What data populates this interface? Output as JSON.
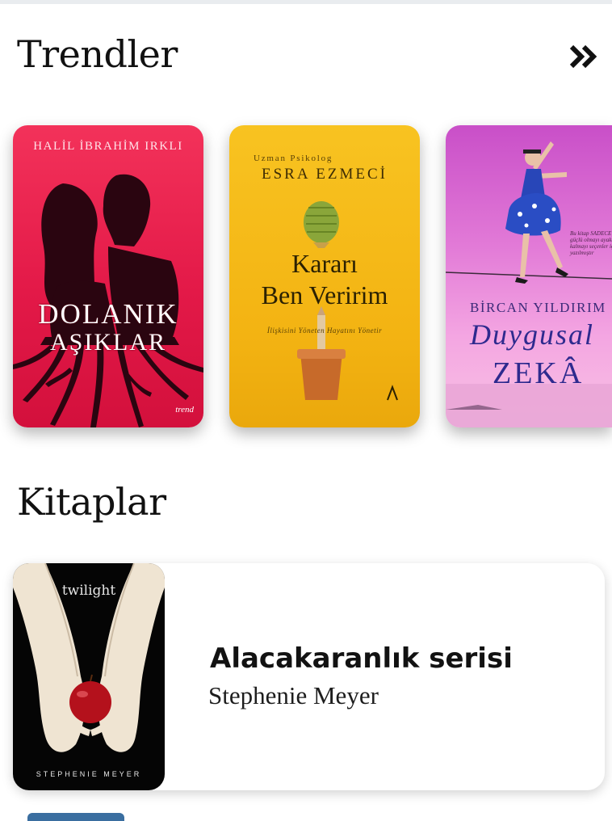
{
  "sections": {
    "trending_title": "Trendler",
    "books_title": "Kitaplar"
  },
  "icons": {
    "more": "double-chevron-right-icon"
  },
  "trending": [
    {
      "author": "HALİL İBRAHİM IRKLI",
      "title_line1": "DOLANIK",
      "title_line2": "AŞIKLAR",
      "publisher": "trend",
      "color": "#e31948"
    },
    {
      "subtitle": "Uzman Psikolog",
      "author": "ESRA EZMECİ",
      "title_line1": "Kararı",
      "title_line2": "Ben Veririm",
      "tagline": "İlişkisini Yöneten   Hayatını Yönetir",
      "color": "#f3b312"
    },
    {
      "note": "Bu kitap SADECE güçlü olmayı ayakta kalmayı seçenler için yazılmıştır",
      "author": "BİRCAN YILDIRIM",
      "title_line1": "Duygusal",
      "title_line2": "ZEKÂ",
      "color": "#e27ad7"
    }
  ],
  "books": [
    {
      "cover_logo": "twilight",
      "cover_author": "STEPHENIE MEYER",
      "title": "Alacakaranlık serisi",
      "author": "Stephenie Meyer"
    }
  ]
}
